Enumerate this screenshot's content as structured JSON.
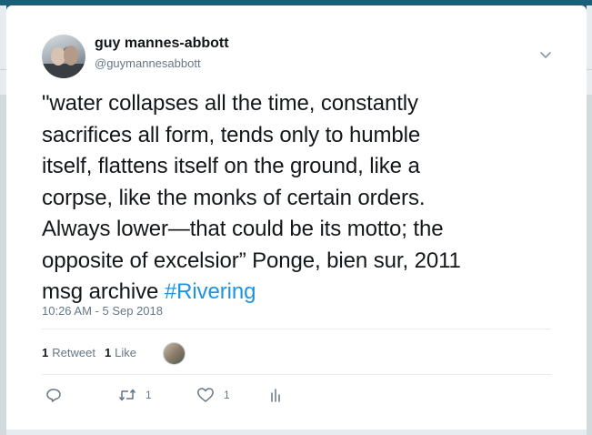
{
  "tweet": {
    "author_name": "guy mannes-abbott",
    "author_handle": "@guymannesabbott",
    "text_lines": [
      "\"water collapses all the time, constantly",
      "sacrifices all form, tends only to humble",
      "itself, flattens itself on the ground, like a",
      "corpse, like the monks of certain orders.",
      "Always lower—that could be its motto; the",
      "opposite of excelsior” Ponge, bien sur, 2011"
    ],
    "last_line_text": "msg archive ",
    "hashtag": "#Rivering",
    "timestamp": "10:26 AM - 5 Sep 2018",
    "stats": {
      "retweet_count": "1",
      "retweet_label": "Retweet",
      "like_count": "1",
      "like_label": "Like"
    },
    "actions": {
      "reply_icon": "reply-icon",
      "retweet_icon": "retweet-icon",
      "retweet_count": "1",
      "like_icon": "heart-icon",
      "like_count": "1",
      "analytics_icon": "analytics-icon"
    }
  },
  "colors": {
    "hashtag": "#1b95e0",
    "muted": "#657786",
    "text": "#14171a",
    "header_bar": "#1c5f79",
    "background": "#e6ecf0"
  }
}
